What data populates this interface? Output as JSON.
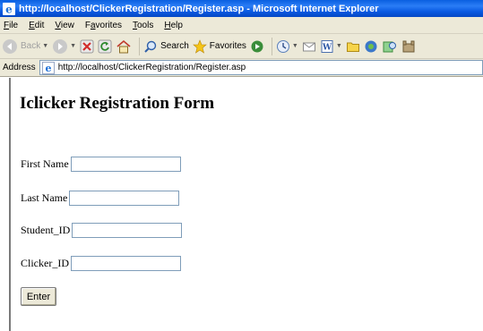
{
  "window": {
    "title": "http://localhost/ClickerRegistration/Register.asp - Microsoft Internet Explorer"
  },
  "menu": {
    "items": [
      {
        "accel": "F",
        "rest": "ile"
      },
      {
        "accel": "E",
        "rest": "dit"
      },
      {
        "accel": "V",
        "rest": "iew"
      },
      {
        "pre": "F",
        "accel": "a",
        "rest": "vorites"
      },
      {
        "accel": "T",
        "rest": "ools"
      },
      {
        "accel": "H",
        "rest": "elp"
      }
    ]
  },
  "toolbar": {
    "back_label": "Back",
    "search_label": "Search",
    "favorites_label": "Favorites"
  },
  "address": {
    "label": "Address",
    "url": "http://localhost/ClickerRegistration/Register.asp"
  },
  "page": {
    "heading": "Iclicker Registration Form",
    "fields": {
      "first_name": {
        "label": "First Name",
        "value": ""
      },
      "last_name": {
        "label": "Last Name",
        "value": ""
      },
      "student_id": {
        "label": "Student_ID",
        "value": ""
      },
      "clicker_id": {
        "label": "Clicker_ID",
        "value": ""
      }
    },
    "submit_label": "Enter"
  }
}
